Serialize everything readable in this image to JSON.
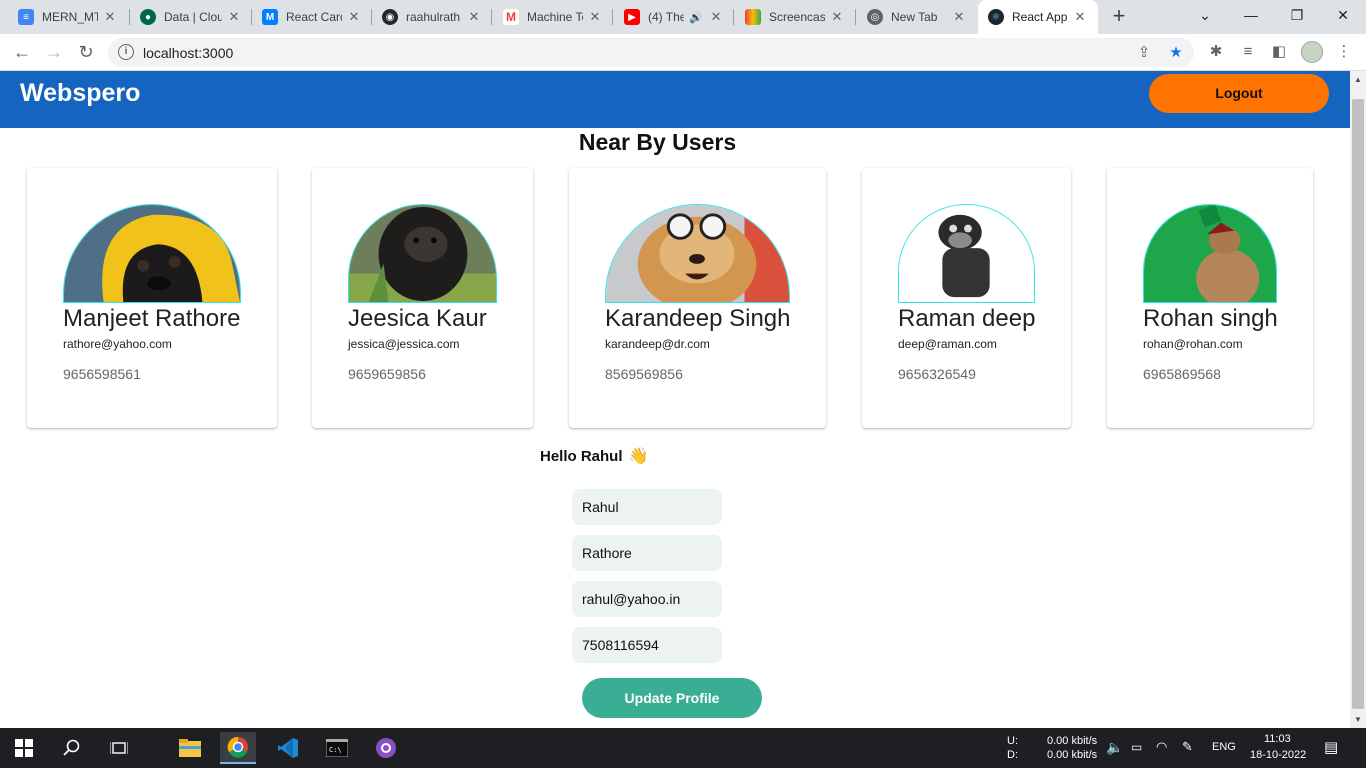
{
  "browser": {
    "tabs": [
      {
        "label": "MERN_MT",
        "icon": "docs-icon",
        "color": "#4285f4"
      },
      {
        "label": "Data | Clou",
        "icon": "mongodb-icon",
        "color": "#00684a"
      },
      {
        "label": "React Card",
        "icon": "mui-icon",
        "color": "#007fff"
      },
      {
        "label": "raahulrath",
        "icon": "github-icon",
        "color": "#24292f"
      },
      {
        "label": "Machine Te",
        "icon": "gmail-icon",
        "color": "#ea4335"
      },
      {
        "label": "(4) The",
        "icon": "youtube-icon",
        "color": "#ff0000"
      },
      {
        "label": "Screencast",
        "icon": "screencastify-icon",
        "color": "#f4b400"
      },
      {
        "label": "New Tab",
        "icon": "chrome-icon",
        "color": "#5f6368"
      },
      {
        "label": "React App",
        "icon": "react-icon",
        "color": "#61dafb"
      }
    ],
    "url": "localhost:3000"
  },
  "app": {
    "brand": "Webspero",
    "logout_label": "Logout",
    "section_title": "Near By Users",
    "users": [
      {
        "name": "Manjeet Rathore",
        "email": "rathore@yahoo.com",
        "phone": "9656598561"
      },
      {
        "name": "Jeesica Kaur",
        "email": "jessica@jessica.com",
        "phone": "9659659856"
      },
      {
        "name": "Karandeep Singh",
        "email": "karandeep@dr.com",
        "phone": "8569569856"
      },
      {
        "name": "Raman deep",
        "email": "deep@raman.com",
        "phone": "9656326549"
      },
      {
        "name": "Rohan singh",
        "email": "rohan@rohan.com",
        "phone": "6965869568"
      }
    ],
    "greeting": "Hello Rahul",
    "greeting_emoji": "👋",
    "form": {
      "first_name": "Rahul",
      "last_name": "Rathore",
      "email": "rahul@yahoo.in",
      "phone": "7508116594",
      "submit_label": "Update Profile"
    }
  },
  "taskbar": {
    "net_up_label": "U:",
    "net_down_label": "D:",
    "net_up": "0.00 kbit/s",
    "net_down": "0.00 kbit/s",
    "lang": "ENG",
    "time": "11:03",
    "date": "18-10-2022"
  }
}
